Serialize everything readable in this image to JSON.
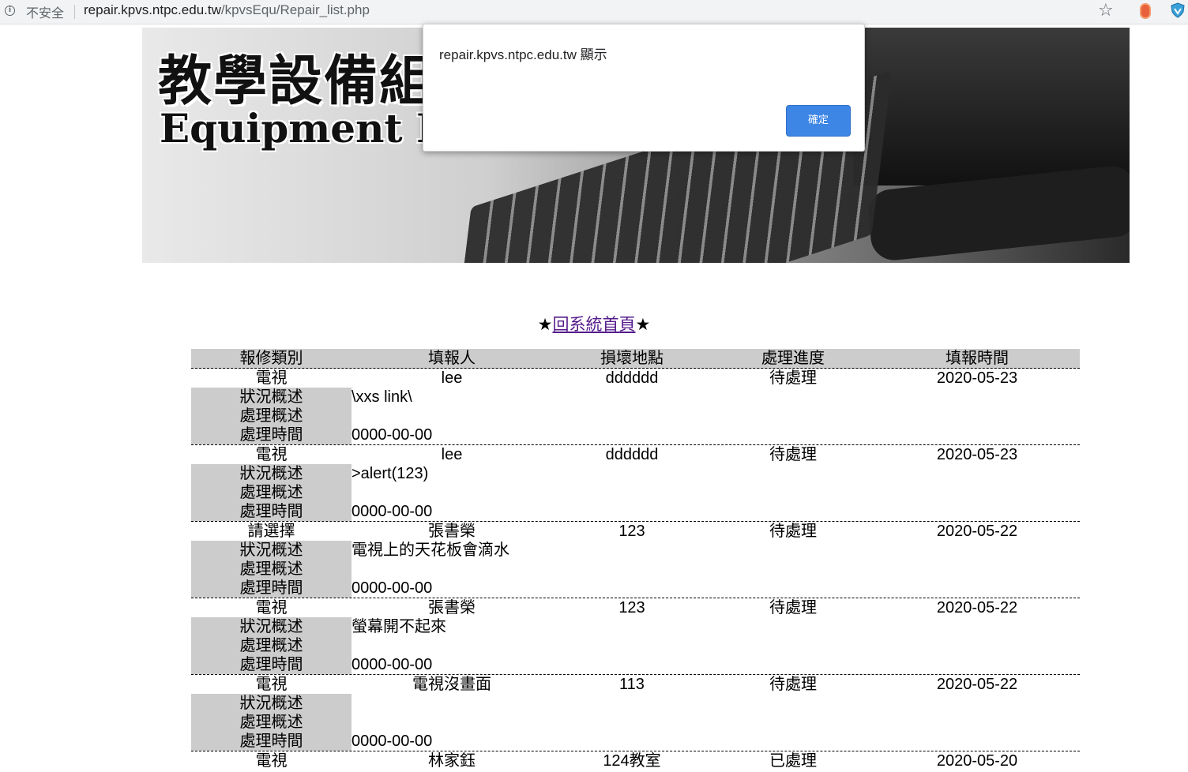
{
  "browser": {
    "security_label": "不安全",
    "url_host": "repair.kpvs.ntpc.edu.tw",
    "url_path": "/kpvsEqu/Repair_list.php"
  },
  "banner": {
    "title_zh": "教學設備組",
    "title_en": "Equipment Re"
  },
  "dialog": {
    "message": "repair.kpvs.ntpc.edu.tw 顯示",
    "ok_label": "確定"
  },
  "home_link": {
    "star_left": "★",
    "label": "回系統首頁",
    "star_right": "★"
  },
  "table": {
    "headers": [
      "報修類別",
      "填報人",
      "損壞地點",
      "處理進度",
      "填報時間"
    ],
    "sub_labels": [
      "狀況概述",
      "處理概述",
      "處理時間"
    ],
    "records": [
      {
        "category": "電視",
        "reporter": "lee",
        "location": "dddddd",
        "status": "待處理",
        "date": "2020-05-23",
        "condition": "\\xxs link\\",
        "handling": "",
        "handled_time": "0000-00-00"
      },
      {
        "category": "電視",
        "reporter": "lee",
        "location": "dddddd",
        "status": "待處理",
        "date": "2020-05-23",
        "condition": ">alert(123)",
        "handling": "",
        "handled_time": "0000-00-00"
      },
      {
        "category": "請選擇",
        "reporter": "張書榮",
        "location": "123",
        "status": "待處理",
        "date": "2020-05-22",
        "condition": "電視上的天花板會滴水",
        "handling": "",
        "handled_time": "0000-00-00"
      },
      {
        "category": "電視",
        "reporter": "張書榮",
        "location": "123",
        "status": "待處理",
        "date": "2020-05-22",
        "condition": "螢幕開不起來",
        "handling": "",
        "handled_time": "0000-00-00"
      },
      {
        "category": "電視",
        "reporter": "電視沒畫面",
        "location": "113",
        "status": "待處理",
        "date": "2020-05-22",
        "condition": "",
        "handling": "",
        "handled_time": "0000-00-00"
      },
      {
        "category": "電視",
        "reporter": "林家鈺",
        "location": "124教室",
        "status": "已處理",
        "date": "2020-05-20",
        "condition": "",
        "handling": "",
        "handled_time": ""
      }
    ]
  }
}
